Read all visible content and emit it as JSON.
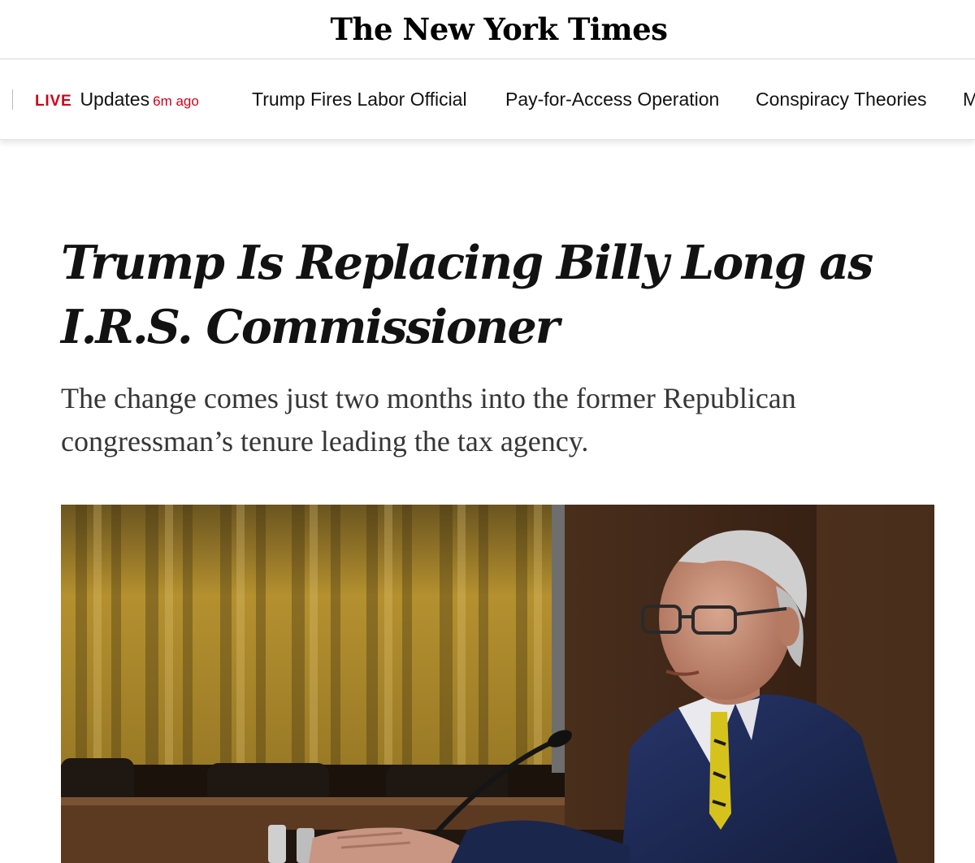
{
  "masthead": {
    "logo_text": "The New York Times"
  },
  "nav": {
    "live": {
      "badge": "LIVE",
      "label": "Updates",
      "time": "6m ago"
    },
    "items": [
      {
        "label": "Trump Fires Labor Official"
      },
      {
        "label": "Pay-for-Access Operation"
      },
      {
        "label": "Conspiracy Theories"
      },
      {
        "label": "M"
      }
    ]
  },
  "article": {
    "headline": "Trump Is Replacing Billy Long as I.R.S. Commissioner",
    "summary": "The change comes just two months into the former Republican congressman’s tenure leading the tax agency."
  },
  "colors": {
    "live_red": "#d0021b",
    "curtain_gold": "#b8952c",
    "suit_navy": "#1f2c55"
  }
}
